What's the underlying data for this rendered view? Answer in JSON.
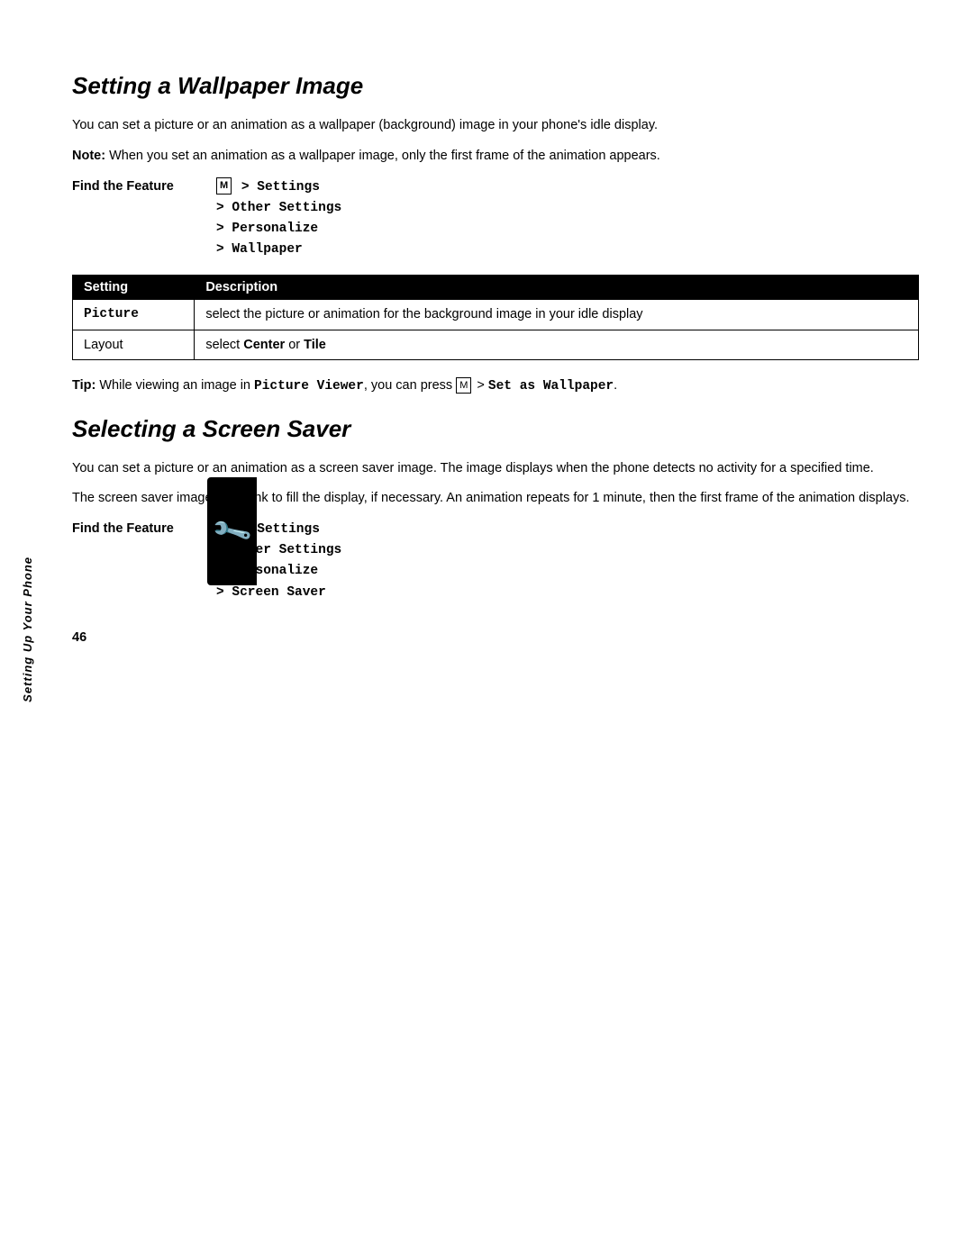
{
  "page": {
    "number": "46",
    "sidebar_label": "Setting Up Your Phone"
  },
  "wallpaper_section": {
    "title": "Setting a Wallpaper Image",
    "intro": "You can set a picture or an animation as a wallpaper (background) image in your phone's idle display.",
    "note_label": "Note:",
    "note_text": "When you set an animation as a wallpaper image, only the first frame of the animation appears.",
    "find_feature_label": "Find the Feature",
    "find_feature_path_1": "M > Settings",
    "find_feature_path_2": "> Other Settings",
    "find_feature_path_3": "> Personalize",
    "find_feature_path_4": "> Wallpaper",
    "table": {
      "col1_header": "Setting",
      "col2_header": "Description",
      "rows": [
        {
          "setting": "Picture",
          "description": "select the picture or animation for the background image in your idle display"
        },
        {
          "setting": "Layout",
          "description_prefix": "select ",
          "description_bold1": "Center",
          "description_mid": " or ",
          "description_bold2": "Tile"
        }
      ]
    },
    "tip_label": "Tip:",
    "tip_text_1": "While viewing an image in ",
    "tip_viewer": "Picture Viewer",
    "tip_text_2": ", you can press ",
    "tip_menu": "M",
    "tip_text_3": " > ",
    "tip_command": "Set as Wallpaper",
    "tip_text_4": "."
  },
  "screensaver_section": {
    "title": "Selecting a Screen Saver",
    "para1": "You can set a picture or an animation as a screen saver image. The image displays when the phone detects no activity for a specified time.",
    "para2": "The screen saver image is shrunk to fill the display, if necessary. An animation repeats for 1 minute, then the first frame of the animation displays.",
    "find_feature_label": "Find the Feature",
    "find_feature_path_1": "M > Settings",
    "find_feature_path_2": "> Other Settings",
    "find_feature_path_3": "> Personalize",
    "find_feature_path_4": "> Screen Saver"
  }
}
